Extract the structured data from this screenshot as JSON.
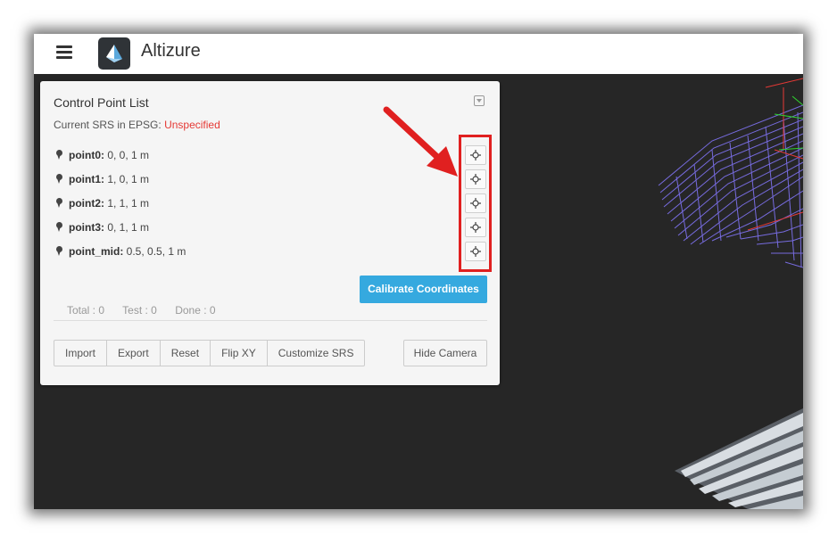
{
  "app": {
    "title": "Altizure"
  },
  "panel": {
    "title": "Control Point List",
    "srs_label": "Current SRS in EPSG:",
    "srs_value": "Unspecified",
    "points": [
      {
        "name": "point0:",
        "coords": "0, 0, 1 m"
      },
      {
        "name": "point1:",
        "coords": "1, 0, 1 m"
      },
      {
        "name": "point2:",
        "coords": "1, 1, 1 m"
      },
      {
        "name": "point3:",
        "coords": "0, 1, 1 m"
      },
      {
        "name": "point_mid:",
        "coords": "0.5, 0.5, 1 m"
      }
    ],
    "calibrate_label": "Calibrate Coordinates",
    "stats": {
      "total": "Total : 0",
      "test": "Test : 0",
      "done": "Done : 0"
    },
    "buttons": {
      "import": "Import",
      "export": "Export",
      "reset": "Reset",
      "flip_xy": "Flip XY",
      "customize_srs": "Customize SRS",
      "hide_camera": "Hide Camera"
    }
  },
  "colors": {
    "accent": "#35a9df",
    "highlight": "#e02020",
    "srs_unspecified": "#e53935",
    "viewport_bg": "#262626",
    "wireframe": "#7b6fe8"
  },
  "icons": [
    "menu-icon",
    "altizure-logo-icon",
    "collapse-icon",
    "map-pin-icon",
    "crosshair-icon"
  ]
}
